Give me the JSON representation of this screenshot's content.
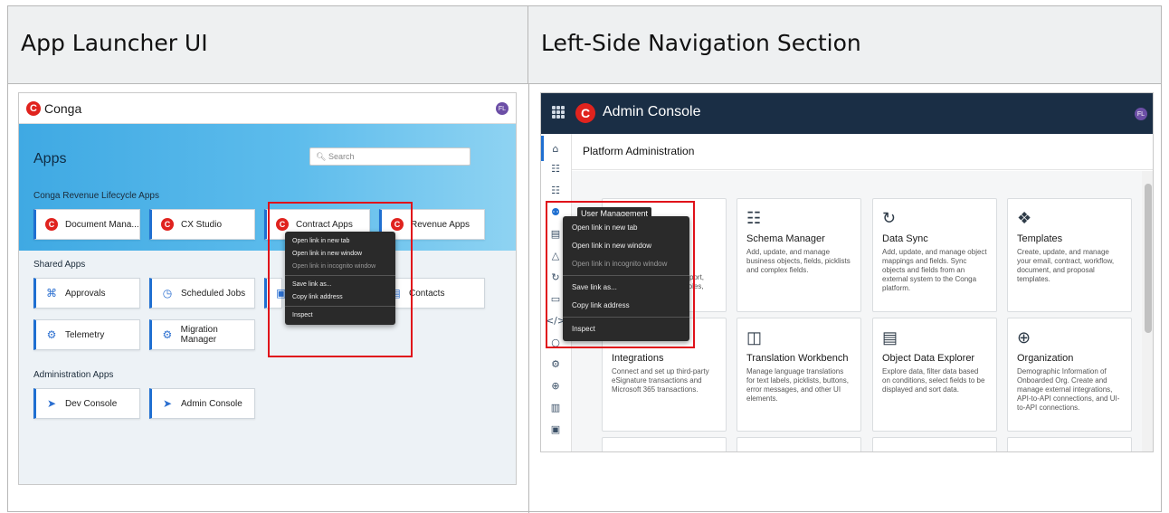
{
  "headers": {
    "left": "App Launcher UI",
    "right": "Left-Side Navigation Section"
  },
  "launcher": {
    "brand": "Conga",
    "logo_letter": "C",
    "avatar": "FL",
    "title": "Apps",
    "search_placeholder": "Search",
    "sections": [
      "Conga Revenue Lifecycle Apps",
      "Shared Apps",
      "Administration Apps"
    ],
    "revenue_apps": [
      "Document Mana...",
      "CX Studio",
      "Contract Apps",
      "Revenue Apps"
    ],
    "shared_apps": [
      "Approvals",
      "Scheduled Jobs",
      "Contacts",
      "Telemetry",
      "Migration Manager"
    ],
    "admin_apps": [
      "Dev Console",
      "Admin Console"
    ],
    "context_menu": [
      "Open link in new tab",
      "Open link in new window",
      "Open link in incognito window",
      "Save link as...",
      "Copy link address",
      "Inspect"
    ]
  },
  "admin": {
    "title": "Admin Console",
    "logo_letter": "C",
    "avatar": "FL",
    "page_title": "Platform Administration",
    "tooltip": "User Management",
    "context_menu": [
      "Open link in new tab",
      "Open link in new window",
      "Open link in incognito window",
      "Save link as...",
      "Copy link address",
      "Inspect"
    ],
    "partial_desc": [
      "xport,",
      "roles,"
    ],
    "cards": [
      {
        "title": "Schema Manager",
        "desc": "Add, update, and manage business objects, fields, picklists and complex fields."
      },
      {
        "title": "Data Sync",
        "desc": "Add, update, and manage object mappings and fields. Sync objects and fields from an external system to the Conga platform."
      },
      {
        "title": "Templates",
        "desc": "Create, update, and manage your email, contract, workflow, document, and proposal templates."
      },
      {
        "title": "Integrations",
        "desc": "Connect and set up third-party eSignature transactions and Microsoft 365 transactions."
      },
      {
        "title": "Translation Workbench",
        "desc": "Manage language translations for text labels, picklists, buttons, error messages, and other UI elements."
      },
      {
        "title": "Object Data Explorer",
        "desc": "Explore data, filter data based on conditions, select fields to be displayed and sort data."
      },
      {
        "title": "Organization",
        "desc": "Demographic Information of Onboarded Org. Create and manage external integrations, API-to-API connections, and UI-to-API connections."
      }
    ]
  },
  "colors": {
    "brand_red": "#e0231e",
    "highlight_box": "#e0111a",
    "nav_dark": "#1a2e45",
    "accent_blue": "#1f6fd1"
  }
}
